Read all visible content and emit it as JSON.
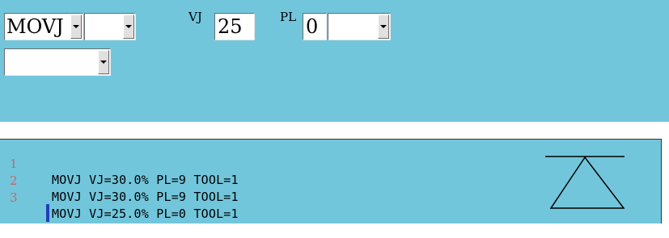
{
  "instruction_editor": {
    "command_select": {
      "value": "MOVJ"
    },
    "option_select_1": {
      "value": ""
    },
    "vj_label": "VJ",
    "vj_value": "25",
    "pl_label": "PL",
    "pl_value": "0",
    "option_select_2": {
      "value": ""
    },
    "option_select_3": {
      "value": ""
    }
  },
  "program": {
    "lines": [
      {
        "number": "1",
        "text": "MOVJ VJ=30.0% PL=9 TOOL=1"
      },
      {
        "number": "2",
        "text": "MOVJ VJ=30.0% PL=9 TOOL=1"
      },
      {
        "number": "3",
        "text": "MOVJ VJ=25.0% PL=0 TOOL=1"
      }
    ]
  },
  "colors": {
    "panel_bg": "#72c6dc",
    "line_number": "#c66666",
    "caret": "#1e3fb8"
  },
  "icons": {
    "top_right": "delta-triangle-icon"
  }
}
